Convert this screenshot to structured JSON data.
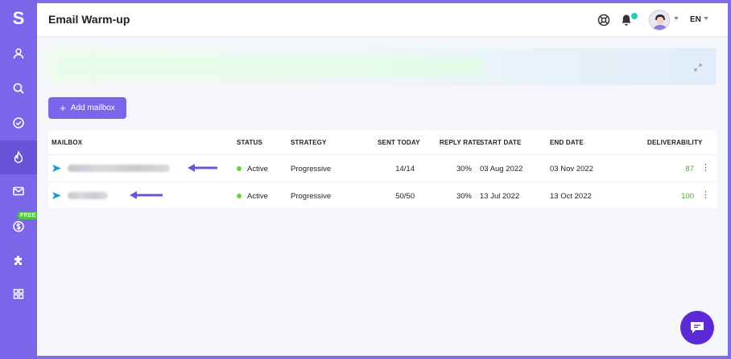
{
  "app": {
    "logo": "S"
  },
  "sidebar": {
    "items": [
      {
        "name": "profile",
        "icon": "user-icon"
      },
      {
        "name": "search",
        "icon": "search-icon"
      },
      {
        "name": "tasks",
        "icon": "check-circle-icon"
      },
      {
        "name": "warmup",
        "icon": "flame-icon",
        "active": true
      },
      {
        "name": "email",
        "icon": "mail-icon"
      },
      {
        "name": "pricing",
        "icon": "dollar-icon",
        "badge": "FREE"
      },
      {
        "name": "integrations",
        "icon": "puzzle-icon"
      },
      {
        "name": "apps",
        "icon": "grid-icon"
      }
    ]
  },
  "header": {
    "title": "Email Warm-up",
    "language": "EN"
  },
  "toolbar": {
    "add_mailbox_label": "Add mailbox"
  },
  "table": {
    "headers": {
      "mailbox": "MAILBOX",
      "status": "STATUS",
      "strategy": "STRATEGY",
      "sent_today": "SENT TODAY",
      "reply_rate": "REPLY RATE",
      "start_date": "START DATE",
      "end_date": "END DATE",
      "deliverability": "DELIVERABILITY"
    },
    "rows": [
      {
        "status": "Active",
        "strategy": "Progressive",
        "sent_today": "14/14",
        "reply_rate": "30%",
        "start_date": "03 Aug 2022",
        "end_date": "03 Nov 2022",
        "deliverability": "87"
      },
      {
        "status": "Active",
        "strategy": "Progressive",
        "sent_today": "50/50",
        "reply_rate": "30%",
        "start_date": "13 Jul 2022",
        "end_date": "13 Oct 2022",
        "deliverability": "100"
      }
    ]
  },
  "colors": {
    "brand": "#7b66ea",
    "active_status": "#6bd13f",
    "deliverability": "#4aa82e",
    "chat": "#5b2ad6",
    "notification": "#1ed1b5"
  }
}
